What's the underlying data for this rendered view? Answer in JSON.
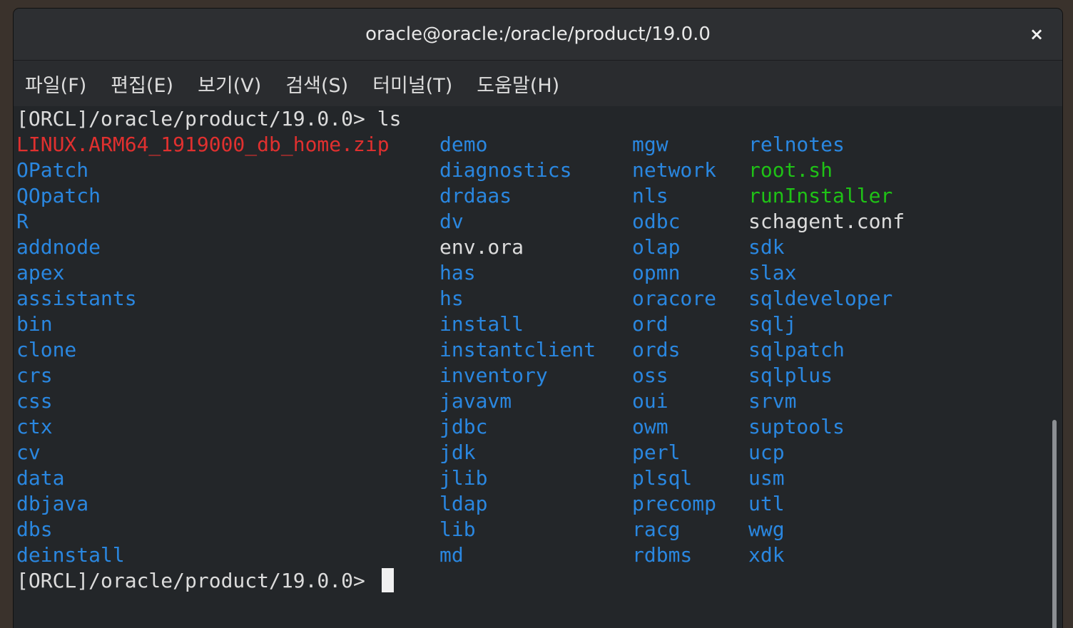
{
  "window": {
    "title": "oracle@oracle:/oracle/product/19.0.0",
    "close_symbol": "×"
  },
  "menu": [
    {
      "label": "파일(F)"
    },
    {
      "label": "편집(E)"
    },
    {
      "label": "보기(V)"
    },
    {
      "label": "검색(S)"
    },
    {
      "label": "터미널(T)"
    },
    {
      "label": "도움말(H)"
    }
  ],
  "terminal": {
    "prompt_line_1": "[ORCL]/oracle/product/19.0.0> ls",
    "prompt_line_2": "[ORCL]/oracle/product/19.0.0> ",
    "colors": {
      "background": "#232629",
      "directory": "#2a87e0",
      "executable": "#1fc216",
      "archive": "#e0302f",
      "file": "#dcdcdc"
    },
    "columns": [
      [
        {
          "name": "LINUX.ARM64_1919000_db_home.zip",
          "type": "zip"
        },
        {
          "name": "OPatch",
          "type": "dir"
        },
        {
          "name": "QOpatch",
          "type": "dir"
        },
        {
          "name": "R",
          "type": "dir"
        },
        {
          "name": "addnode",
          "type": "dir"
        },
        {
          "name": "apex",
          "type": "dir"
        },
        {
          "name": "assistants",
          "type": "dir"
        },
        {
          "name": "bin",
          "type": "dir"
        },
        {
          "name": "clone",
          "type": "dir"
        },
        {
          "name": "crs",
          "type": "dir"
        },
        {
          "name": "css",
          "type": "dir"
        },
        {
          "name": "ctx",
          "type": "dir"
        },
        {
          "name": "cv",
          "type": "dir"
        },
        {
          "name": "data",
          "type": "dir"
        },
        {
          "name": "dbjava",
          "type": "dir"
        },
        {
          "name": "dbs",
          "type": "dir"
        },
        {
          "name": "deinstall",
          "type": "dir"
        }
      ],
      [
        {
          "name": "demo",
          "type": "dir"
        },
        {
          "name": "diagnostics",
          "type": "dir"
        },
        {
          "name": "drdaas",
          "type": "dir"
        },
        {
          "name": "dv",
          "type": "dir"
        },
        {
          "name": "env.ora",
          "type": "file"
        },
        {
          "name": "has",
          "type": "dir"
        },
        {
          "name": "hs",
          "type": "dir"
        },
        {
          "name": "install",
          "type": "dir"
        },
        {
          "name": "instantclient",
          "type": "dir"
        },
        {
          "name": "inventory",
          "type": "dir"
        },
        {
          "name": "javavm",
          "type": "dir"
        },
        {
          "name": "jdbc",
          "type": "dir"
        },
        {
          "name": "jdk",
          "type": "dir"
        },
        {
          "name": "jlib",
          "type": "dir"
        },
        {
          "name": "ldap",
          "type": "dir"
        },
        {
          "name": "lib",
          "type": "dir"
        },
        {
          "name": "md",
          "type": "dir"
        }
      ],
      [
        {
          "name": "mgw",
          "type": "dir"
        },
        {
          "name": "network",
          "type": "dir"
        },
        {
          "name": "nls",
          "type": "dir"
        },
        {
          "name": "odbc",
          "type": "dir"
        },
        {
          "name": "olap",
          "type": "dir"
        },
        {
          "name": "opmn",
          "type": "dir"
        },
        {
          "name": "oracore",
          "type": "dir"
        },
        {
          "name": "ord",
          "type": "dir"
        },
        {
          "name": "ords",
          "type": "dir"
        },
        {
          "name": "oss",
          "type": "dir"
        },
        {
          "name": "oui",
          "type": "dir"
        },
        {
          "name": "owm",
          "type": "dir"
        },
        {
          "name": "perl",
          "type": "dir"
        },
        {
          "name": "plsql",
          "type": "dir"
        },
        {
          "name": "precomp",
          "type": "dir"
        },
        {
          "name": "racg",
          "type": "dir"
        },
        {
          "name": "rdbms",
          "type": "dir"
        }
      ],
      [
        {
          "name": "relnotes",
          "type": "dir"
        },
        {
          "name": "root.sh",
          "type": "exe"
        },
        {
          "name": "runInstaller",
          "type": "exe"
        },
        {
          "name": "schagent.conf",
          "type": "file"
        },
        {
          "name": "sdk",
          "type": "dir"
        },
        {
          "name": "slax",
          "type": "dir"
        },
        {
          "name": "sqldeveloper",
          "type": "dir"
        },
        {
          "name": "sqlj",
          "type": "dir"
        },
        {
          "name": "sqlpatch",
          "type": "dir"
        },
        {
          "name": "sqlplus",
          "type": "dir"
        },
        {
          "name": "srvm",
          "type": "dir"
        },
        {
          "name": "suptools",
          "type": "dir"
        },
        {
          "name": "ucp",
          "type": "dir"
        },
        {
          "name": "usm",
          "type": "dir"
        },
        {
          "name": "utl",
          "type": "dir"
        },
        {
          "name": "wwg",
          "type": "dir"
        },
        {
          "name": "xdk",
          "type": "dir"
        }
      ]
    ]
  }
}
